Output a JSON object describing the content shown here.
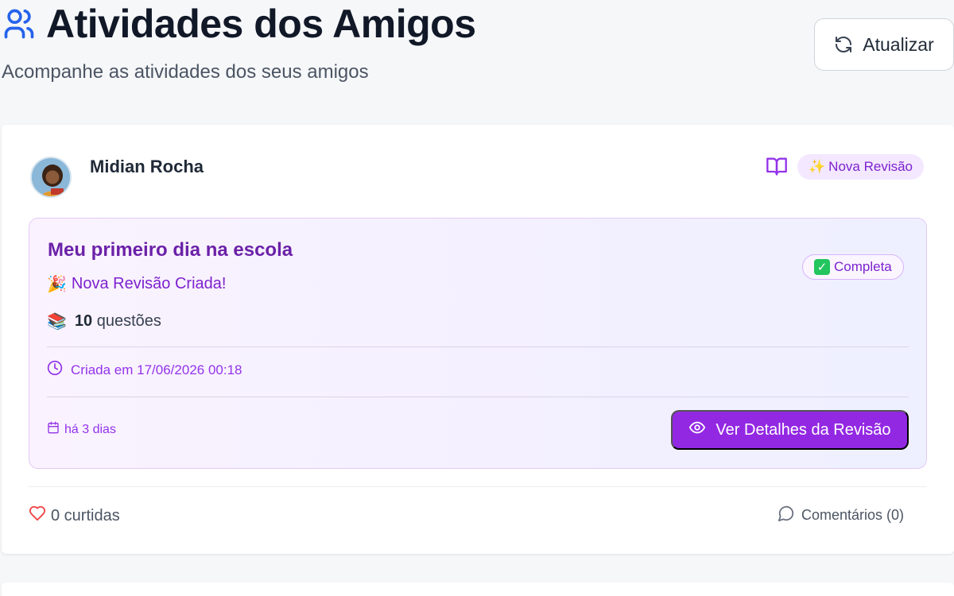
{
  "header": {
    "title": "Atividades dos Amigos",
    "subtitle": "Acompanhe as atividades dos seus amigos",
    "refresh_label": "Atualizar"
  },
  "activity": {
    "user_name": "Midian Rocha",
    "type_badge_emoji": "✨",
    "type_badge": "Nova Revisão",
    "review_title": "Meu primeiro dia na escola",
    "status_emoji": "✓",
    "status": "Completa",
    "event_emoji": "🎉",
    "event_text": "Nova Revisão Criada!",
    "questions_emoji": "📚",
    "questions_count": "10",
    "questions_label": "questões",
    "created_text": "Criada em 17/06/2026 00:18",
    "relative_date": "há 3 dias",
    "details_button": "Ver Detalhes da Revisão",
    "likes_text": "0 curtidas",
    "comments_text": "Comentários (0)"
  },
  "colors": {
    "accent_purple": "#9328e3",
    "title_blue": "#2563eb",
    "heart_red": "#ef4444"
  }
}
